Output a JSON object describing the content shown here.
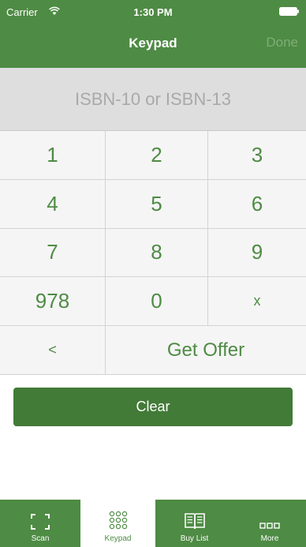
{
  "status_bar": {
    "carrier": "Carrier",
    "time": "1:30 PM"
  },
  "nav": {
    "title": "Keypad",
    "done_label": "Done"
  },
  "isbn": {
    "placeholder": "ISBN-10 or ISBN-13",
    "value": ""
  },
  "keys": {
    "k1": "1",
    "k2": "2",
    "k3": "3",
    "k4": "4",
    "k5": "5",
    "k6": "6",
    "k7": "7",
    "k8": "8",
    "k9": "9",
    "k978": "978",
    "k0": "0",
    "kx": "x",
    "back": "<",
    "get_offer": "Get Offer"
  },
  "clear_label": "Clear",
  "tabs": [
    {
      "label": "Scan",
      "icon": "scan-frame-icon"
    },
    {
      "label": "Keypad",
      "icon": "keypad-dots-icon"
    },
    {
      "label": "Buy List",
      "icon": "book-icon"
    },
    {
      "label": "More",
      "icon": "more-icon"
    }
  ],
  "colors": {
    "brand_green": "#4e8b44",
    "clear_button": "#427a37",
    "field_bg": "#dedede"
  }
}
